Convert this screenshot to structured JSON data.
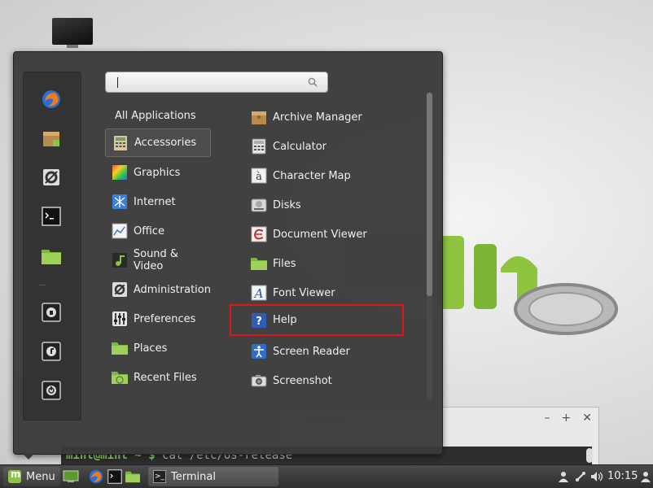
{
  "desktop": {
    "terminal_command": "cat /etc/os-release",
    "terminal_prompt": "mint@mint ~ $"
  },
  "search": {
    "value": "",
    "placeholder": ""
  },
  "categories": [
    {
      "label": "All Applications",
      "icon": "none"
    },
    {
      "label": "Accessories",
      "icon": "calculator-icon"
    },
    {
      "label": "Graphics",
      "icon": "graphics-icon"
    },
    {
      "label": "Internet",
      "icon": "internet-icon"
    },
    {
      "label": "Office",
      "icon": "office-icon"
    },
    {
      "label": "Sound & Video",
      "icon": "sound-video-icon"
    },
    {
      "label": "Administration",
      "icon": "administration-icon"
    },
    {
      "label": "Preferences",
      "icon": "preferences-icon"
    },
    {
      "label": "Places",
      "icon": "folder-icon"
    },
    {
      "label": "Recent Files",
      "icon": "recent-files-icon"
    }
  ],
  "selected_category": "Accessories",
  "apps": [
    {
      "label": "Archive Manager",
      "icon": "archive-icon"
    },
    {
      "label": "Calculator",
      "icon": "calculator-icon"
    },
    {
      "label": "Character Map",
      "icon": "character-map-icon"
    },
    {
      "label": "Disks",
      "icon": "disks-icon"
    },
    {
      "label": "Document Viewer",
      "icon": "document-viewer-icon"
    },
    {
      "label": "Files",
      "icon": "folder-icon"
    },
    {
      "label": "Font Viewer",
      "icon": "font-viewer-icon"
    },
    {
      "label": "Help",
      "icon": "help-icon"
    },
    {
      "label": "Screen Reader",
      "icon": "accessibility-icon"
    },
    {
      "label": "Screenshot",
      "icon": "camera-icon"
    }
  ],
  "highlighted_app": "Help",
  "favorites": [
    "firefox-icon",
    "software-manager-icon",
    "system-settings-icon",
    "terminal-icon",
    "files-folder-icon",
    "lock-screen-icon",
    "logout-icon",
    "power-icon"
  ],
  "panel": {
    "menu_label": "Menu",
    "task_label": "Terminal",
    "clock": "10:15"
  },
  "colors": {
    "highlight_border": "#e2151b",
    "mint_green": "#8ac640"
  }
}
